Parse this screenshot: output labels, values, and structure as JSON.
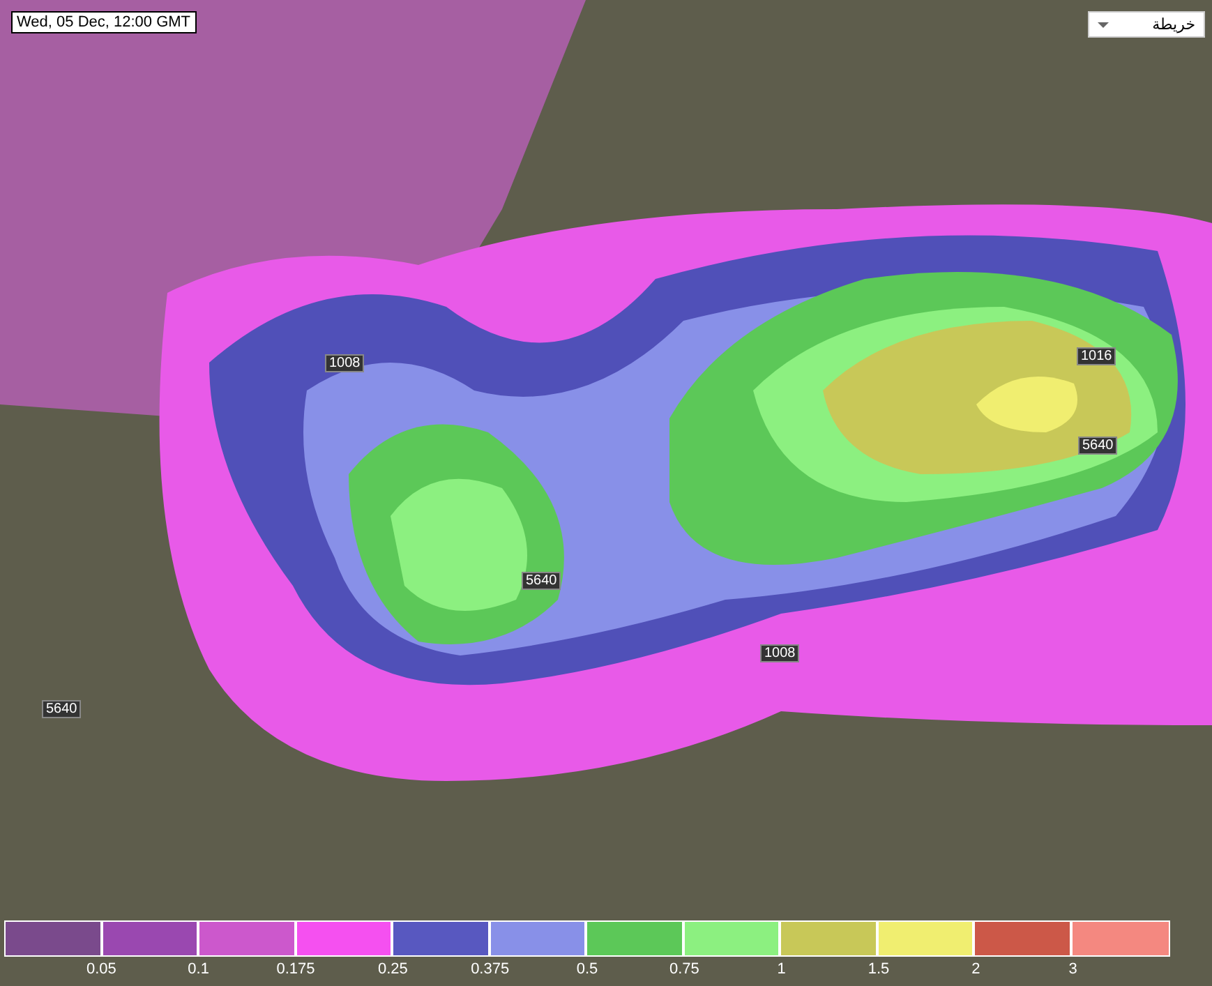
{
  "timestamp": "Wed, 05 Dec, 12:00 GMT",
  "layer_select": {
    "value": "خريطة"
  },
  "contour_labels": [
    "1008",
    "5640",
    "1016",
    "5640",
    "1008",
    "5640"
  ],
  "legend": {
    "swatches": [
      {
        "color": "#7a4a8c"
      },
      {
        "color": "#9a48b0"
      },
      {
        "color": "#cc58cc"
      },
      {
        "color": "#f550f0"
      },
      {
        "color": "#5858c0"
      },
      {
        "color": "#8890e8"
      },
      {
        "color": "#5cc858"
      },
      {
        "color": "#8cf080"
      },
      {
        "color": "#c8c858"
      },
      {
        "color": "#f0ee70"
      },
      {
        "color": "#cc5848"
      },
      {
        "color": "#f48880"
      }
    ],
    "labels": [
      "0.05",
      "0.1",
      "0.175",
      "0.25",
      "0.375",
      "0.5",
      "0.75",
      "1",
      "1.5",
      "2",
      "3"
    ]
  }
}
